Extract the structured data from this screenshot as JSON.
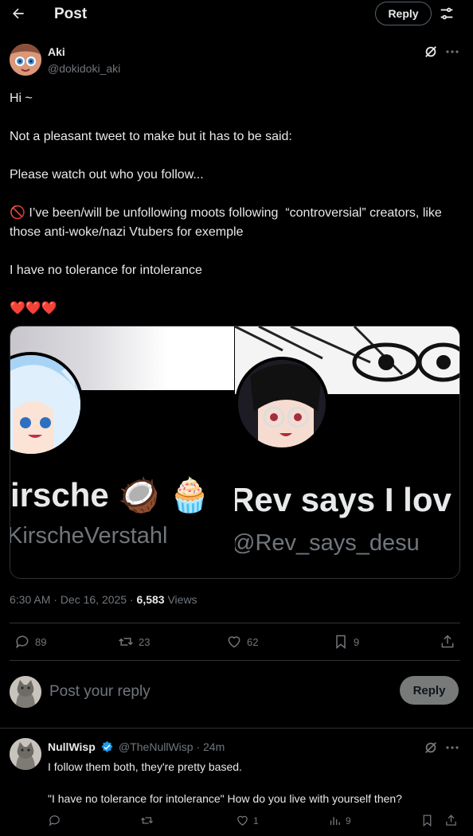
{
  "header": {
    "title": "Post",
    "reply_button": "Reply"
  },
  "author": {
    "name": "Aki",
    "handle": "@dokidoki_aki"
  },
  "tweet": {
    "lines": [
      "Hi ~",
      "Not a pleasant tweet to make but it has to be said:",
      "Please watch out who you follow...",
      "🚫 I’ve been/will be unfollowing moots following  “controversial” creators, like those anti-woke/nazi Vtubers for exemple",
      "I have no tolerance for intolerance",
      "❤️❤️❤️"
    ]
  },
  "media": {
    "left": {
      "name": "irsche 🥥 🧁",
      "handle": "KirscheVerstahl"
    },
    "right": {
      "name": "Rev says I lov",
      "handle": "@Rev_says_desu"
    }
  },
  "meta": {
    "time": "6:30 AM · Dec 16, 2025 · ",
    "views_count": "6,583",
    "views_label": " Views"
  },
  "actions": {
    "replies": "89",
    "reposts": "23",
    "likes": "62",
    "bookmarks": "9"
  },
  "reply_box": {
    "placeholder": "Post your reply",
    "submit": "Reply"
  },
  "reply": {
    "name": "NullWisp",
    "handle": "@TheNullWisp · 24m",
    "line1": "I follow them both, they're pretty based.",
    "line2": "\"I have no tolerance for intolerance\" How do you live with yourself then?",
    "likes": "1",
    "views": "9"
  },
  "colors": {
    "background": "#000000",
    "text": "#e7e9ea",
    "secondary": "#71767b",
    "divider": "#2f3336",
    "verified": "#1d9bf0"
  }
}
